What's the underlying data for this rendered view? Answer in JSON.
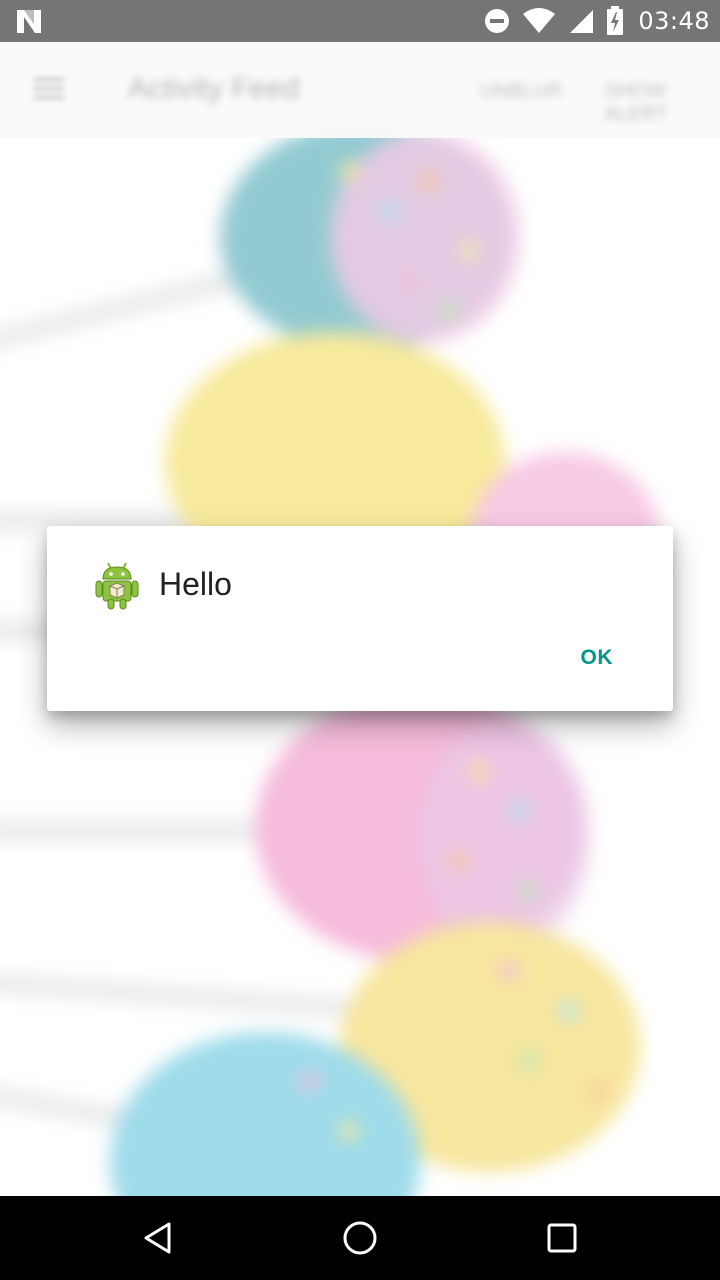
{
  "status_bar": {
    "time": "03:48",
    "icons": [
      "n-logo-icon",
      "do-not-disturb-icon",
      "wifi-icon",
      "cell-signal-icon",
      "battery-icon"
    ]
  },
  "app_bar": {
    "title": "Activity Feed",
    "actions": [
      "Unblur",
      "Show Alert"
    ]
  },
  "dialog": {
    "icon": "android-robot-icon",
    "title": "Hello",
    "positive_button": "OK",
    "accent_color": "#009688"
  },
  "nav_bar": {
    "buttons": [
      "back-icon",
      "home-icon",
      "recents-icon"
    ]
  },
  "background": {
    "description_colors": [
      "#4aa7b5",
      "#f3dc5a",
      "#f08fc4",
      "#5fc4dd"
    ]
  }
}
